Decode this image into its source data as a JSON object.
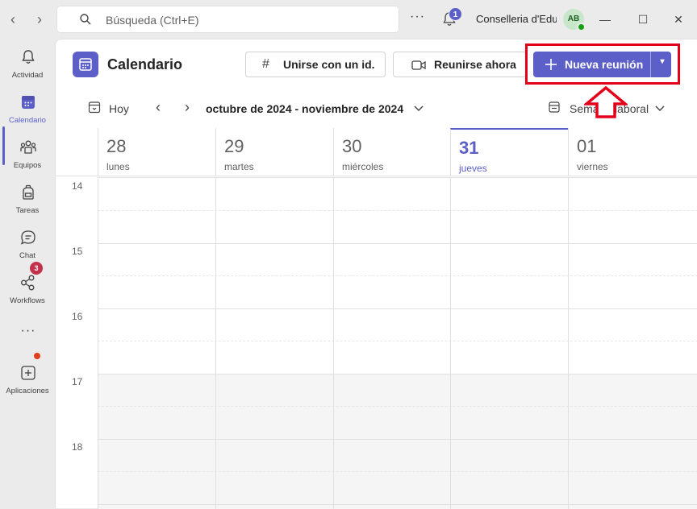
{
  "titlebar": {
    "search_placeholder": "Búsqueda (Ctrl+E)",
    "notification_count": "1",
    "org_name": "Conselleria d'Edu...",
    "avatar_initials": "AB"
  },
  "rail": {
    "items": [
      {
        "label": "Actividad",
        "icon": "bell-icon"
      },
      {
        "label": "Calendario",
        "icon": "calendar-icon"
      },
      {
        "label": "Equipos",
        "icon": "teams-icon"
      },
      {
        "label": "Tareas",
        "icon": "backpack-icon"
      },
      {
        "label": "Chat",
        "icon": "chat-icon",
        "badge": "3"
      },
      {
        "label": "Workflows",
        "icon": "workflows-icon"
      },
      {
        "label": "",
        "icon": "more-icon"
      },
      {
        "label": "Aplicaciones",
        "icon": "add-apps-icon"
      }
    ]
  },
  "header": {
    "title": "Calendario",
    "join_with_id": "Unirse con un id.",
    "meet_now": "Reunirse ahora",
    "new_meeting": "Nueva reunión"
  },
  "toolbar": {
    "today": "Hoy",
    "date_range": "octubre de 2024 - noviembre de 2024",
    "view": "Semana laboral"
  },
  "days": [
    {
      "num": "28",
      "name": "lunes",
      "today": false
    },
    {
      "num": "29",
      "name": "martes",
      "today": false
    },
    {
      "num": "30",
      "name": "miércoles",
      "today": false
    },
    {
      "num": "31",
      "name": "jueves",
      "today": true
    },
    {
      "num": "01",
      "name": "viernes",
      "today": false
    }
  ],
  "hours": [
    "14",
    "15",
    "16",
    "17",
    "18"
  ],
  "colors": {
    "accent": "#5b5fc7",
    "highlight": "#e4001b"
  }
}
